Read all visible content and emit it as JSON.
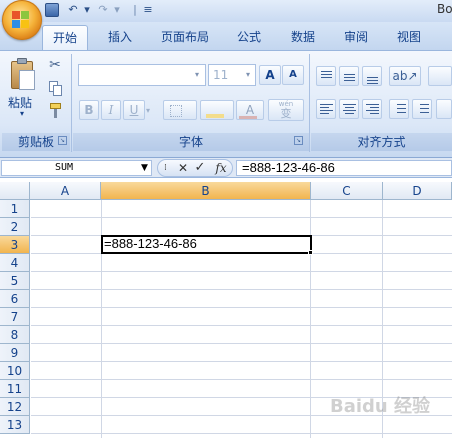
{
  "title_partial": "Bo",
  "qat": {
    "undo": "↶",
    "redo": "↷",
    "dropdown": "▾",
    "customize": "≡"
  },
  "tabs": [
    "开始",
    "插入",
    "页面布局",
    "公式",
    "数据",
    "审阅",
    "视图"
  ],
  "ribbon": {
    "clipboard": {
      "paste_label": "粘贴",
      "group_label": "剪贴板"
    },
    "font": {
      "font_size": "11",
      "grow": "A",
      "shrink": "A",
      "bold": "B",
      "italic": "I",
      "underline": "U",
      "wen": "wén",
      "wen_char": "变",
      "font_color_letter": "A",
      "group_label": "字体"
    },
    "alignment": {
      "group_label": "对齐方式"
    }
  },
  "formula_bar": {
    "name_box": "SUM",
    "cancel": "✕",
    "enter": "✓",
    "fx": "fx",
    "formula": "=888-123-46-86"
  },
  "grid": {
    "columns": [
      "A",
      "B",
      "C",
      "D"
    ],
    "selected_column": "B",
    "rows": [
      "1",
      "2",
      "3",
      "4",
      "5",
      "6",
      "7",
      "8",
      "9",
      "10",
      "11",
      "12",
      "13"
    ],
    "selected_row": "3",
    "active_cell": {
      "ref": "B3",
      "content": "=888-123-46-86"
    }
  },
  "watermark": "Baidu 经验",
  "colors": {
    "accent": "#15428b",
    "selected_header": "#f5c266",
    "ribbon": "#dbe7f7",
    "gridline": "#d0d7e5"
  }
}
